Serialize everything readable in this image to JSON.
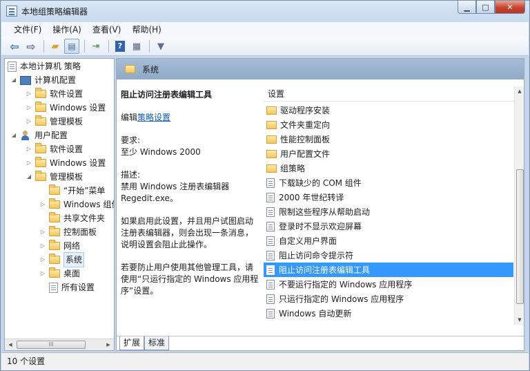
{
  "window": {
    "title": "本地组策略编辑器"
  },
  "menu": [
    "文件(F)",
    "操作(A)",
    "查看(V)",
    "帮助(H)"
  ],
  "toolbar": {
    "icons": [
      "back-arrow-icon",
      "forward-arrow-icon",
      "up-folder-icon",
      "show-hide-tree-icon",
      "export-list-icon",
      "help-icon",
      "properties-icon",
      "filter-icon"
    ]
  },
  "tree": {
    "items": [
      {
        "label": "本地计算机 策略",
        "icon": "doc-icon",
        "exp": ""
      },
      {
        "label": "计算机配置",
        "icon": "pc-icon",
        "exp": "◢"
      },
      {
        "label": "软件设置",
        "icon": "folder",
        "exp": "▷"
      },
      {
        "label": "Windows 设置",
        "icon": "folder",
        "exp": "▷"
      },
      {
        "label": "管理模板",
        "icon": "folder",
        "exp": "▷"
      },
      {
        "label": "用户配置",
        "icon": "user-icon",
        "exp": "◢"
      },
      {
        "label": "软件设置",
        "icon": "folder",
        "exp": "▷"
      },
      {
        "label": "Windows 设置",
        "icon": "folder",
        "exp": "▷"
      },
      {
        "label": "管理模板",
        "icon": "folder",
        "exp": "◢"
      },
      {
        "label": "“开始”菜单",
        "icon": "folder",
        "exp": ""
      },
      {
        "label": "Windows 组件",
        "icon": "folder",
        "exp": "▷"
      },
      {
        "label": "共享文件夹",
        "icon": "folder",
        "exp": ""
      },
      {
        "label": "控制面板",
        "icon": "folder",
        "exp": "▷"
      },
      {
        "label": "网络",
        "icon": "folder",
        "exp": "▷"
      },
      {
        "label": "系统",
        "icon": "folder",
        "exp": "▷"
      },
      {
        "label": "桌面",
        "icon": "folder",
        "exp": "▷"
      },
      {
        "label": "所有设置",
        "icon": "doc-icon",
        "exp": ""
      }
    ],
    "scroll_grip": "III"
  },
  "right": {
    "header": "系统",
    "description": {
      "title": "阻止访问注册表编辑工具",
      "edit_prefix": "编辑",
      "edit_link": "策略设置",
      "req_label": "要求:",
      "req_value": "至少 Windows 2000",
      "desc_label": "描述:",
      "desc_value": "禁用 Windows 注册表编辑器 Regedit.exe。",
      "para1": "如果启用此设置，并且用户试图启动注册表编辑器，则会出现一条消息，说明设置会阻止此操作。",
      "para2": "若要防止用户使用其他管理工具，请使用“只运行指定的 Windows 应用程序”设置。"
    },
    "column_header": "设置",
    "settings": [
      {
        "label": "驱动程序安装",
        "type": "folder"
      },
      {
        "label": "文件夹重定向",
        "type": "folder"
      },
      {
        "label": "性能控制面板",
        "type": "folder"
      },
      {
        "label": "用户配置文件",
        "type": "folder"
      },
      {
        "label": "组策略",
        "type": "folder"
      },
      {
        "label": "下载缺少的 COM 组件",
        "type": "setting"
      },
      {
        "label": "2000 年世纪转译",
        "type": "setting"
      },
      {
        "label": "限制这些程序从帮助启动",
        "type": "setting"
      },
      {
        "label": "登录时不显示欢迎屏幕",
        "type": "setting"
      },
      {
        "label": "自定义用户界面",
        "type": "setting"
      },
      {
        "label": "阻止访问命令提示符",
        "type": "setting"
      },
      {
        "label": "阻止访问注册表编辑工具",
        "type": "setting",
        "selected": true
      },
      {
        "label": "不要运行指定的 Windows 应用程序",
        "type": "setting"
      },
      {
        "label": "只运行指定的 Windows 应用程序",
        "type": "setting"
      },
      {
        "label": "Windows 自动更新",
        "type": "setting"
      }
    ],
    "tabs": [
      "扩展",
      "标准"
    ]
  },
  "status": {
    "text": "10 个设置"
  }
}
